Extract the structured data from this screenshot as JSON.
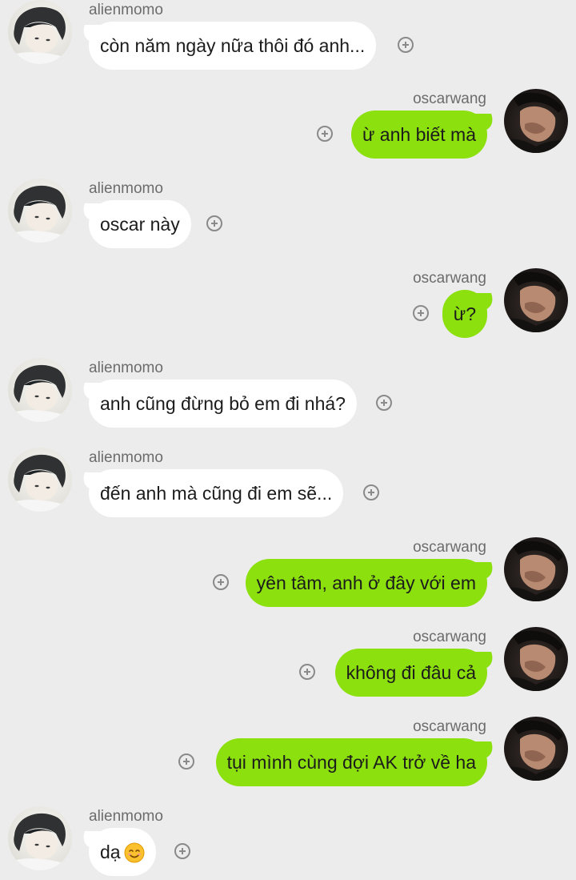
{
  "participants": {
    "left": "alienmomo",
    "right": "oscarwang"
  },
  "messages": [
    {
      "sender": "alienmomo",
      "side": "left",
      "text": "còn năm ngày nữa thôi đó anh..."
    },
    {
      "sender": "oscarwang",
      "side": "right",
      "text": "ừ anh biết mà"
    },
    {
      "sender": "alienmomo",
      "side": "left",
      "text": "oscar này"
    },
    {
      "sender": "oscarwang",
      "side": "right",
      "text": "ừ?"
    },
    {
      "sender": "alienmomo",
      "side": "left",
      "text": "anh cũng đừng bỏ em đi nhá?"
    },
    {
      "sender": "alienmomo",
      "side": "left",
      "text": "đến anh mà cũng đi em sẽ..."
    },
    {
      "sender": "oscarwang",
      "side": "right",
      "text": "yên tâm, anh ở đây với em"
    },
    {
      "sender": "oscarwang",
      "side": "right",
      "text": "không đi đâu cả"
    },
    {
      "sender": "oscarwang",
      "side": "right",
      "text": "tụi mình cùng đợi AK trở về ha"
    },
    {
      "sender": "alienmomo",
      "side": "left",
      "text": "dạ",
      "emoji": "smiling-face-emoji"
    }
  ],
  "colors": {
    "background": "#ececec",
    "incoming_bubble": "#ffffff",
    "outgoing_bubble": "#8be00d",
    "username_text": "#6c6c6c"
  }
}
